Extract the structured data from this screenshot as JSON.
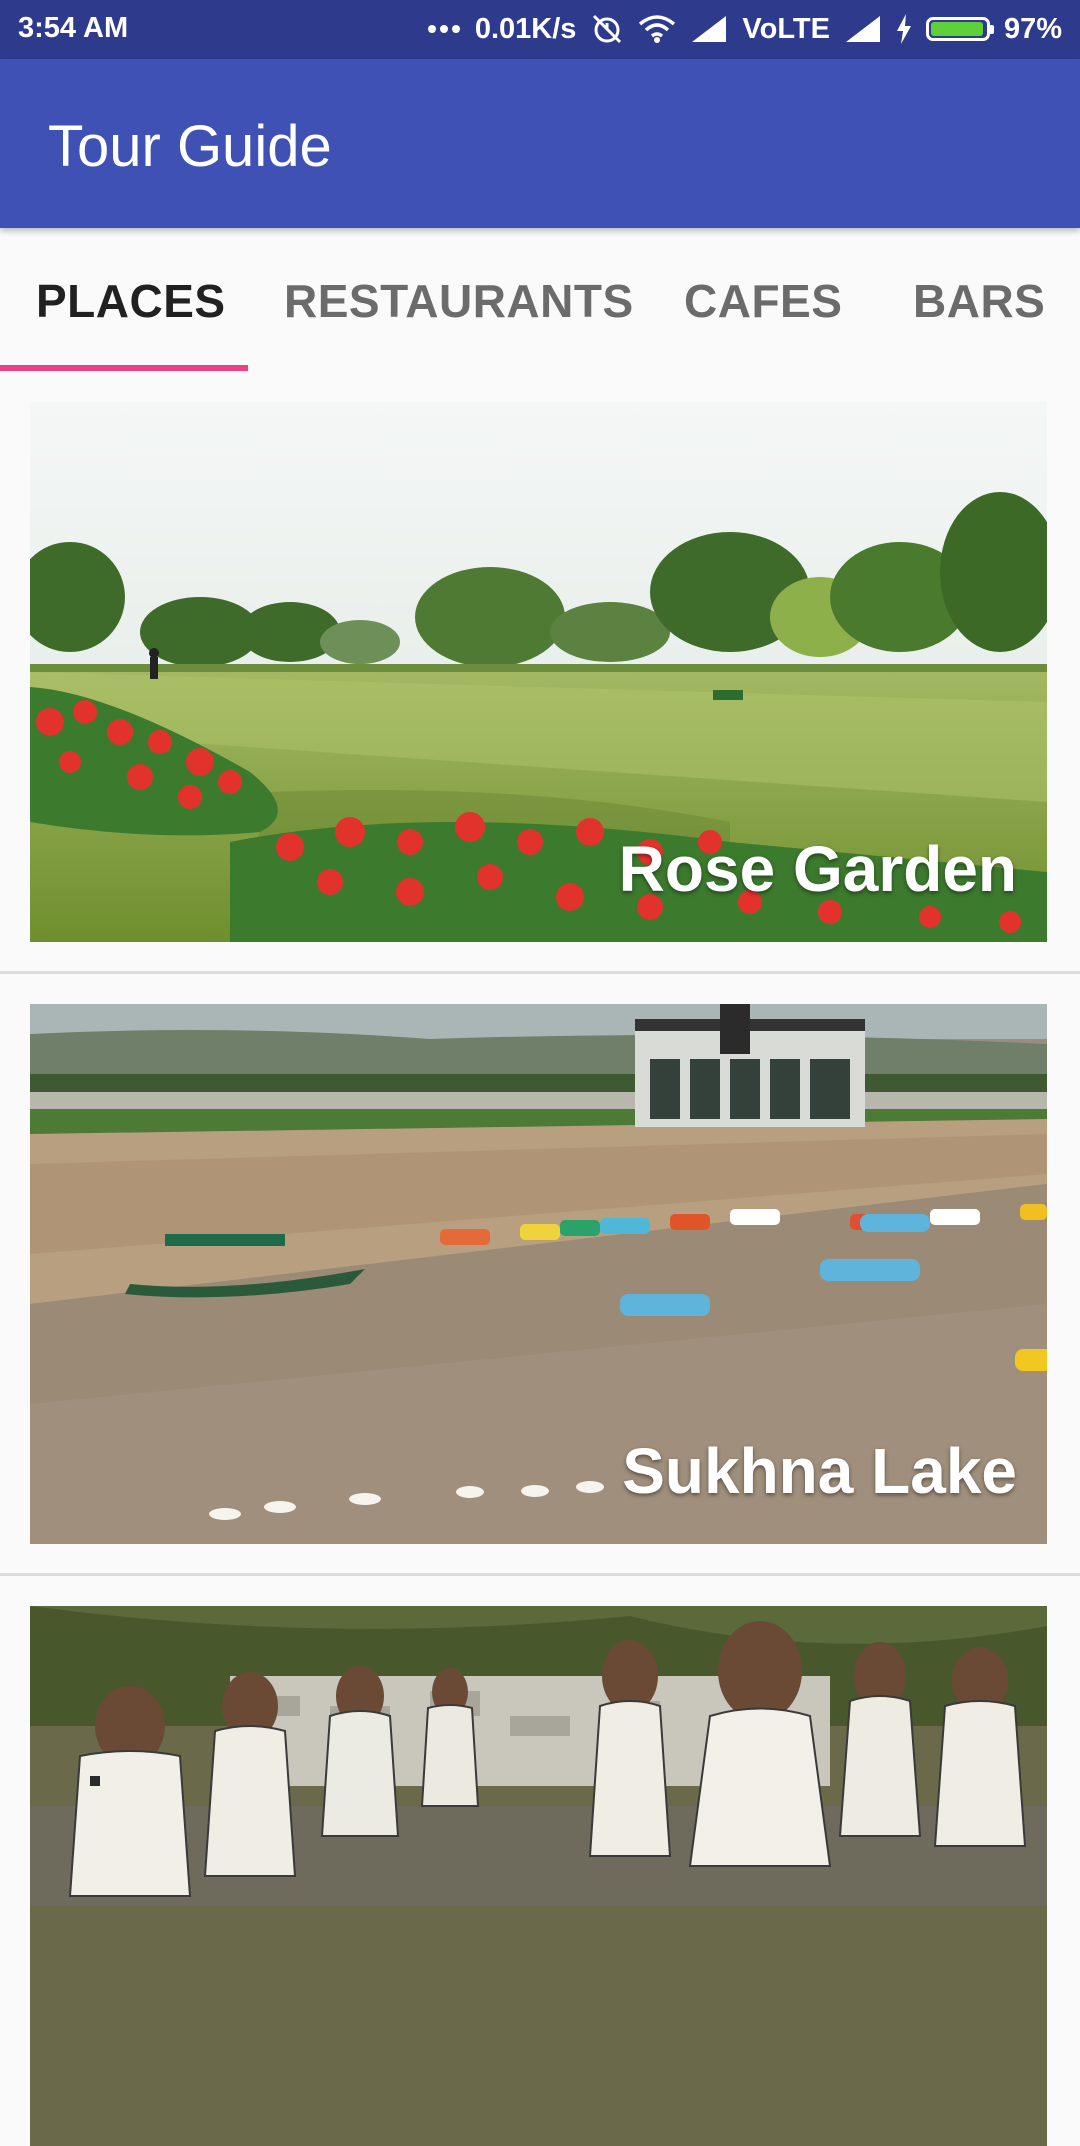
{
  "status_bar": {
    "time": "3:54 AM",
    "network_speed": "0.01K/s",
    "network_type": "VoLTE",
    "battery_percent": "97%",
    "battery_level": 0.97,
    "icons": [
      "more-dots-icon",
      "alarm-off-icon",
      "wifi-icon",
      "signal-icon",
      "signal-icon",
      "charging-icon",
      "battery-icon"
    ]
  },
  "app_bar": {
    "title": "Tour Guide",
    "color": "#3f51b5"
  },
  "tabs": [
    {
      "label": "PLACES",
      "active": true
    },
    {
      "label": "RESTAURANTS",
      "active": false
    },
    {
      "label": "CAFES",
      "active": false
    },
    {
      "label": "BARS",
      "active": false
    }
  ],
  "accent_color": "#ee4082",
  "places": [
    {
      "name": "Rose Garden"
    },
    {
      "name": "Sukhna Lake"
    },
    {
      "name": ""
    }
  ]
}
